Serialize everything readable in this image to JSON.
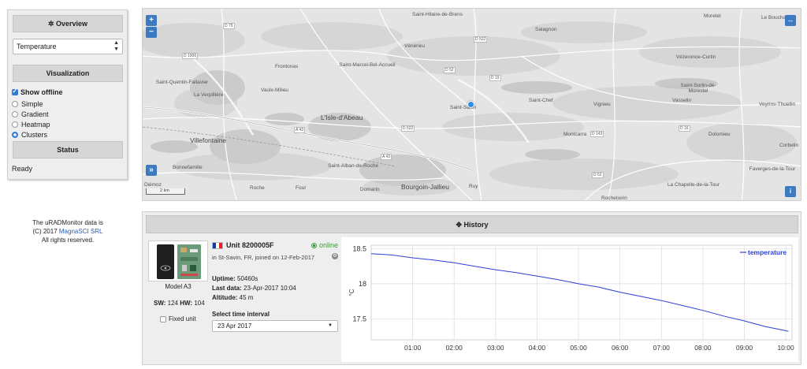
{
  "left_panel": {
    "overview_icon": "gear-icon",
    "overview_label": "Overview",
    "parameter_select": "Temperature",
    "visualization_label": "Visualization",
    "show_offline_label": "Show offline",
    "show_offline_checked": true,
    "viz_options": [
      {
        "label": "Simple",
        "selected": false
      },
      {
        "label": "Gradient",
        "selected": false
      },
      {
        "label": "Heatmap",
        "selected": false
      },
      {
        "label": "Clusters",
        "selected": true
      }
    ],
    "status_label": "Status",
    "status_text": "Ready"
  },
  "map": {
    "zoom_in": "+",
    "zoom_out": "−",
    "expand_icon": "expand-arrows-icon",
    "sidebar_toggle": "»",
    "info_icon": "i",
    "scale_label": "2 km",
    "marker_color": "#2f8fe0",
    "places": [
      "Saint-Hilaire-de-Brens",
      "Moretel",
      "Le Bouchage",
      "Salagnon",
      "Vénérieu",
      "Frontonas",
      "Saint-Marcel-Bel-Accueil",
      "Vézeronce-Curtin",
      "Saint-Sorlin-de-Morestel",
      "Saint-Quentin-Fallavier",
      "La Verpillière",
      "Saint-Savin",
      "Saint-Chef",
      "Vignieu",
      "Vasselin",
      "L'Isle-d'Abeau",
      "Villefontaine",
      "Montcarra",
      "Dolomieu",
      "Corbelin",
      "Bonnefamille",
      "Saint-Alban-de-Roche",
      "Bourgoin-Jallieu",
      "Ruy",
      "Faverges-de-la-Tour",
      "La Chapelle-de-la-Tour",
      "Roche",
      "Four",
      "Domarin",
      "Diémoz",
      "Rochetoirin",
      "Veyrins-Thuellin",
      "Vaulx-Milieu"
    ],
    "roads": [
      "D 75",
      "D 522",
      "D 1006",
      "D 52",
      "D 19",
      "A 43",
      "D 143",
      "D 16",
      "D 522",
      "A 43",
      "D 52"
    ]
  },
  "attribution": {
    "line1": "The uRADMonitor data is",
    "line2_prefix": "(C) 2017 ",
    "line2_link": "MagnaSCI SRL",
    "line3": "All rights reserved."
  },
  "history": {
    "title_icon": "move-icon",
    "title": "History",
    "device": {
      "model_link": "Model A3",
      "sw_label": "SW:",
      "sw_value": "124",
      "hw_label": "HW:",
      "hw_value": "104",
      "fixed_unit_label": "Fixed unit",
      "fixed_unit_checked": false
    },
    "unit": {
      "flag_icon": "france-flag-icon",
      "name": "Unit 8200005F",
      "status": "online",
      "status_color": "#2ea02e",
      "location": "in St-Savin, FR, joined on 12-Feb-2017",
      "uptime_label": "Uptime:",
      "uptime_value": "50460s",
      "last_data_label": "Last data:",
      "last_data_value": "23-Apr-2017 10:04",
      "altitude_label": "Altitude:",
      "altitude_value": "45 m",
      "interval_label": "Select time interval",
      "interval_value": "23 Apr 2017"
    }
  },
  "chart_data": {
    "type": "line",
    "series": [
      {
        "name": "temperature",
        "color": "#2b3fd6",
        "x": [
          "00:00",
          "00:30",
          "01:00",
          "01:30",
          "02:00",
          "02:30",
          "03:00",
          "03:30",
          "04:00",
          "04:30",
          "05:00",
          "05:30",
          "06:00",
          "06:30",
          "07:00",
          "07:30",
          "08:00",
          "08:30",
          "09:00",
          "09:30",
          "10:00",
          "10:04"
        ],
        "values": [
          18.43,
          18.41,
          18.37,
          18.34,
          18.3,
          18.25,
          18.2,
          18.16,
          18.11,
          18.06,
          18.0,
          17.95,
          17.88,
          17.82,
          17.76,
          17.69,
          17.62,
          17.54,
          17.47,
          17.39,
          17.33,
          17.32
        ]
      }
    ],
    "x_ticks": [
      "01:00",
      "02:00",
      "03:00",
      "04:00",
      "05:00",
      "06:00",
      "07:00",
      "08:00",
      "09:00",
      "10:00"
    ],
    "y_ticks": [
      17.5,
      18,
      18.5
    ],
    "ylabel": "°C",
    "ylim": [
      17.2,
      18.55
    ],
    "xlim_hours": [
      0.0,
      10.15
    ],
    "legend": "top-right",
    "grid": true
  }
}
